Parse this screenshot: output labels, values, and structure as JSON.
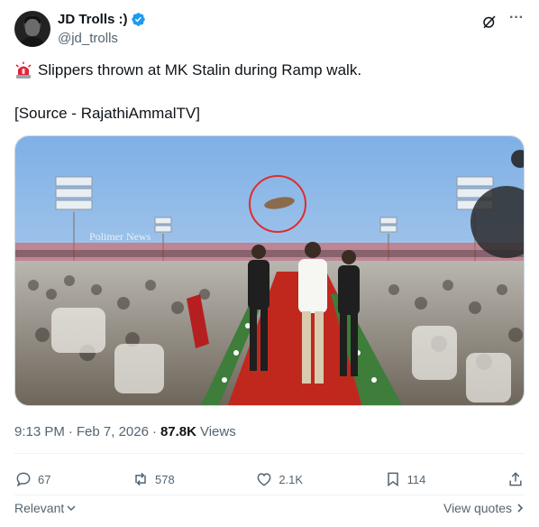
{
  "author": {
    "display_name": "JD Trolls :)",
    "handle": "@jd_trolls"
  },
  "tweet": {
    "line1": "Slippers thrown at MK Stalin during Ramp walk.",
    "line2": "[Source - RajathiAmmalTV]"
  },
  "media": {
    "watermark": "Polimer News"
  },
  "meta": {
    "time": "9:13 PM",
    "separator1": "·",
    "date": "Feb 7, 2026",
    "separator2": "·",
    "views_count": "87.8K",
    "views_label": "Views"
  },
  "actions": {
    "replies": "67",
    "reposts": "578",
    "likes": "2.1K",
    "bookmarks": "114"
  },
  "footer": {
    "sort_label": "Relevant",
    "view_quotes_label": "View quotes"
  },
  "colors": {
    "text": "#0f1419",
    "secondary": "#536471",
    "verified": "#1d9bf0",
    "divider": "#eff3f4"
  }
}
